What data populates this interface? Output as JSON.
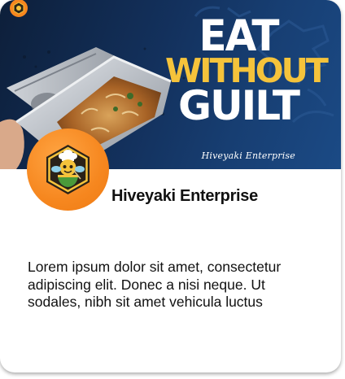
{
  "banner": {
    "headline_line1": "EAT",
    "headline_line2": "WITHOUT",
    "headline_line3": "GUILT",
    "signature": "Hiveyaki Enterprise",
    "colors": {
      "background": "#13315d",
      "headline_white": "#ffffff",
      "headline_yellow": "#f5c33b"
    }
  },
  "logo": {
    "icon": "bee-chef-hexagon-icon",
    "color": "#f6871f"
  },
  "card": {
    "company_name": "Hiveyaki Enterprise",
    "description": "Lorem ipsum dolor sit amet, consectetur adipiscing elit. Donec a nisi neque. Ut sodales, nibh sit amet vehicula luctus"
  }
}
